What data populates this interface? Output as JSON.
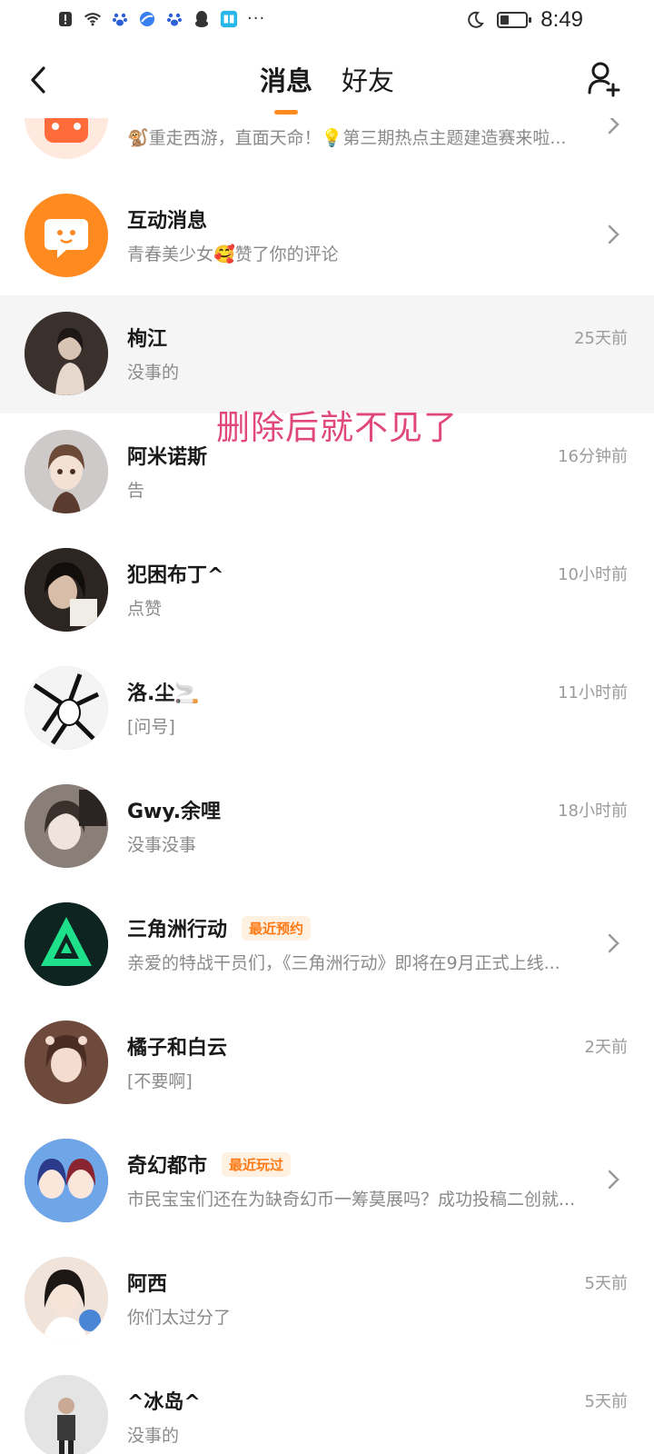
{
  "status_bar": {
    "time": "8:49",
    "left_icons": [
      "alert-icon",
      "wifi-icon",
      "baidu-paw-icon",
      "blue-ball-icon",
      "baidu-paw-icon",
      "qq-penguin-icon",
      "book-icon"
    ],
    "more": "···"
  },
  "header": {
    "tabs": [
      {
        "label": "消息",
        "active": true
      },
      {
        "label": "好友",
        "active": false
      }
    ]
  },
  "annotation": "删除后就不见了",
  "conversations": [
    {
      "name": "",
      "preview": "🐒重走西游，直面天命！💡第三期热点主题建造赛来啦...",
      "time": "",
      "chevron": true,
      "avatar_color": "#ff8a3a"
    },
    {
      "name": "互动消息",
      "preview": "青春美少女🥰赞了你的评论",
      "time": "",
      "chevron": true,
      "avatar_color": "#ff8a1f"
    },
    {
      "name": "栒江",
      "preview": "没事的",
      "time": "25天前",
      "chevron": false,
      "avatar_color": "#5a4e48",
      "highlight": true
    },
    {
      "name": "阿米诺斯",
      "preview": "告",
      "time": "16分钟前",
      "chevron": false,
      "avatar_color": "#c9c4c4"
    },
    {
      "name": "犯困布丁^",
      "preview": "点赞",
      "time": "10小时前",
      "chevron": false,
      "avatar_color": "#4b3f3a"
    },
    {
      "name": "洛.尘🚬",
      "preview": "[问号]",
      "time": "11小时前",
      "chevron": false,
      "avatar_color": "#d8d8d8"
    },
    {
      "name": "Gwy.余哩",
      "preview": "没事没事",
      "time": "18小时前",
      "chevron": false,
      "avatar_color": "#b9a9a0"
    },
    {
      "name": "三角洲行动",
      "tag": "最近预约",
      "preview": "亲爱的特战干员们，《三角洲行动》即将在9月正式上线...",
      "time": "",
      "chevron": true,
      "avatar_color": "#0f2a26"
    },
    {
      "name": "橘子和白云",
      "preview": "[不要啊]",
      "time": "2天前",
      "chevron": false,
      "avatar_color": "#a37a66"
    },
    {
      "name": "奇幻都市",
      "tag": "最近玩过",
      "preview": "市民宝宝们还在为缺奇幻币一筹莫展吗？成功投稿二创就...",
      "time": "",
      "chevron": true,
      "avatar_color": "#3d5bb5"
    },
    {
      "name": "阿西",
      "preview": "你们太过分了",
      "time": "5天前",
      "chevron": false,
      "avatar_color": "#e9d9cf"
    },
    {
      "name": "^冰岛^",
      "preview": "没事的",
      "time": "5天前",
      "chevron": false,
      "avatar_color": "#dddddd"
    }
  ]
}
